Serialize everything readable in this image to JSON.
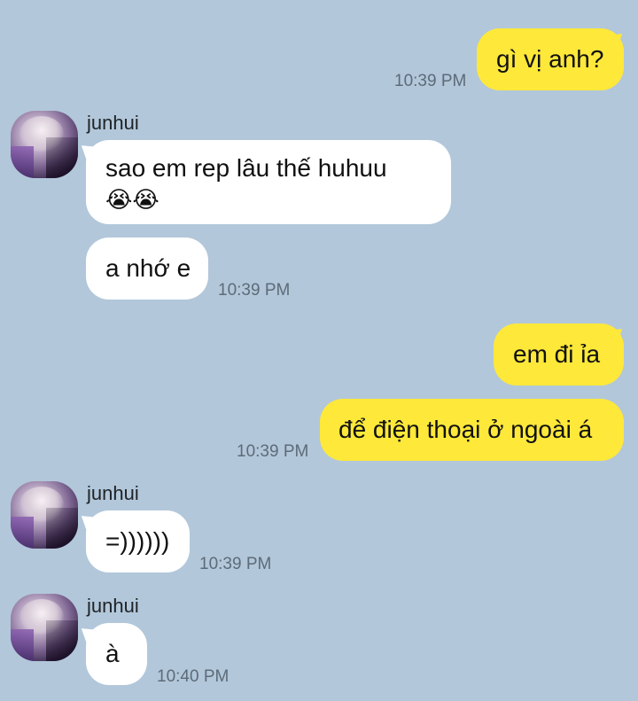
{
  "colors": {
    "background": "#b2c7da",
    "my_bubble": "#fee83a",
    "their_bubble": "#ffffff",
    "timestamp": "#5d6b78"
  },
  "messages": [
    {
      "sender": "me",
      "text": "gì vị anh?",
      "time": "10:39 PM"
    },
    {
      "sender": "junhui",
      "name": "junhui",
      "line1": "sao em rep lâu thế huhuu",
      "line2": "😭😭"
    },
    {
      "sender": "junhui",
      "text": "a nhớ e",
      "time": "10:39 PM"
    },
    {
      "sender": "me",
      "text": "em đi ỉa"
    },
    {
      "sender": "me",
      "text": "để điện thoại ở ngoài á",
      "time": "10:39 PM"
    },
    {
      "sender": "junhui",
      "name": "junhui",
      "text": "=))))))",
      "time": "10:39 PM"
    },
    {
      "sender": "junhui",
      "name": "junhui",
      "text": "à",
      "time": "10:40 PM"
    }
  ]
}
